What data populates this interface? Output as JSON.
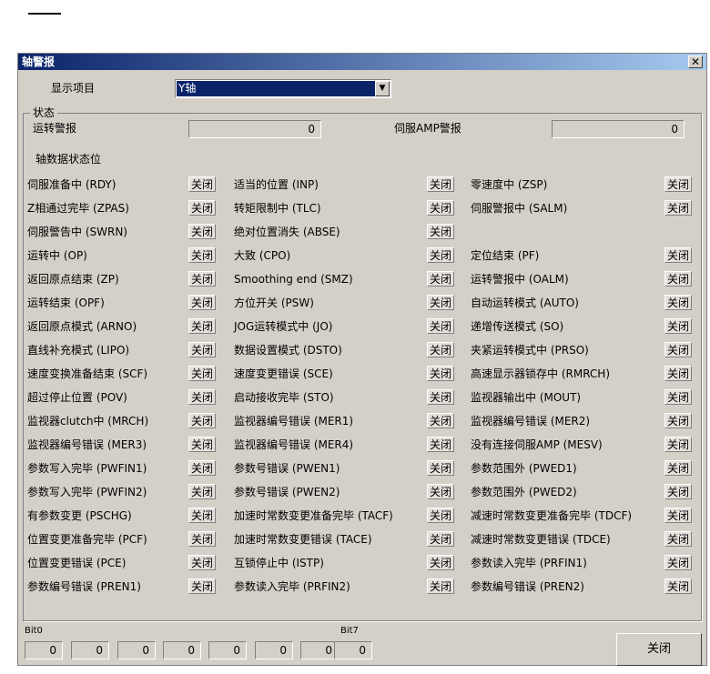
{
  "window": {
    "title": "轴警报",
    "close_glyph": "✕",
    "ok_button": "关闭"
  },
  "display": {
    "label": "显示项目",
    "selected": "Y轴",
    "arrow": "▼"
  },
  "status": {
    "legend": "状态",
    "run_alarm_label": "运转警报",
    "run_alarm_value": "0",
    "servo_amp_label": "伺服AMP警报",
    "servo_amp_value": "0"
  },
  "bits_heading": "轴数据状态位",
  "items": [
    [
      {
        "label": "伺服准备中 (RDY)",
        "state": "关闭"
      },
      {
        "label": "适当的位置 (INP)",
        "state": "关闭"
      },
      {
        "label": "零速度中 (ZSP)",
        "state": "关闭"
      }
    ],
    [
      {
        "label": "Z相通过完毕 (ZPAS)",
        "state": "关闭"
      },
      {
        "label": "转矩限制中 (TLC)",
        "state": "关闭"
      },
      {
        "label": "伺服警报中 (SALM)",
        "state": "关闭"
      }
    ],
    [
      {
        "label": "伺服警告中 (SWRN)",
        "state": "关闭"
      },
      {
        "label": "绝对位置消失 (ABSE)",
        "state": "关闭"
      },
      null
    ],
    [
      {
        "label": "运转中 (OP)",
        "state": "关闭"
      },
      {
        "label": "大致 (CPO)",
        "state": "关闭"
      },
      {
        "label": "定位结束 (PF)",
        "state": "关闭"
      }
    ],
    [
      {
        "label": "返回原点结束 (ZP)",
        "state": "关闭"
      },
      {
        "label": "Smoothing end (SMZ)",
        "state": "关闭"
      },
      {
        "label": "运转警报中 (OALM)",
        "state": "关闭"
      }
    ],
    [
      {
        "label": "运转结束 (OPF)",
        "state": "关闭"
      },
      {
        "label": "方位开关 (PSW)",
        "state": "关闭"
      },
      {
        "label": "自动运转模式 (AUTO)",
        "state": "关闭"
      }
    ],
    [
      {
        "label": "返回原点模式 (ARNO)",
        "state": "关闭"
      },
      {
        "label": "JOG运转模式中 (JO)",
        "state": "关闭"
      },
      {
        "label": "递增传送模式 (SO)",
        "state": "关闭"
      }
    ],
    [
      {
        "label": "直线补充模式 (LIPO)",
        "state": "关闭"
      },
      {
        "label": "数据设置模式 (DSTO)",
        "state": "关闭"
      },
      {
        "label": "夹紧运转模式中 (PRSO)",
        "state": "关闭"
      }
    ],
    [
      {
        "label": "速度变换准备结束 (SCF)",
        "state": "关闭"
      },
      {
        "label": "速度变更错误 (SCE)",
        "state": "关闭"
      },
      {
        "label": "高速显示器锁存中 (RMRCH)",
        "state": "关闭"
      }
    ],
    [
      {
        "label": "超过停止位置 (POV)",
        "state": "关闭"
      },
      {
        "label": "启动接收完毕 (STO)",
        "state": "关闭"
      },
      {
        "label": "监视器输出中 (MOUT)",
        "state": "关闭"
      }
    ],
    [
      {
        "label": "监视器clutch中 (MRCH)",
        "state": "关闭"
      },
      {
        "label": "监视器编号错误 (MER1)",
        "state": "关闭"
      },
      {
        "label": "监视器编号错误 (MER2)",
        "state": "关闭"
      }
    ],
    [
      {
        "label": "监视器编号错误 (MER3)",
        "state": "关闭"
      },
      {
        "label": "监视器编号错误 (MER4)",
        "state": "关闭"
      },
      {
        "label": "没有连接伺服AMP (MESV)",
        "state": "关闭"
      }
    ],
    [
      {
        "label": "参数写入完毕 (PWFIN1)",
        "state": "关闭"
      },
      {
        "label": "参数号错误 (PWEN1)",
        "state": "关闭"
      },
      {
        "label": "参数范围外 (PWED1)",
        "state": "关闭"
      }
    ],
    [
      {
        "label": "参数写入完毕 (PWFIN2)",
        "state": "关闭"
      },
      {
        "label": "参数号错误 (PWEN2)",
        "state": "关闭"
      },
      {
        "label": "参数范围外 (PWED2)",
        "state": "关闭"
      }
    ],
    [
      {
        "label": "有参数变更 (PSCHG)",
        "state": "关闭"
      },
      {
        "label": "加速时常数变更准备完毕 (TACF)",
        "state": "关闭"
      },
      {
        "label": "减速时常数变更准备完毕 (TDCF)",
        "state": "关闭"
      }
    ],
    [
      {
        "label": "位置变更准备完毕 (PCF)",
        "state": "关闭"
      },
      {
        "label": "加速时常数变更错误 (TACE)",
        "state": "关闭"
      },
      {
        "label": "减速时常数变更错误 (TDCE)",
        "state": "关闭"
      }
    ],
    [
      {
        "label": "位置变更错误 (PCE)",
        "state": "关闭"
      },
      {
        "label": "互锁停止中 (ISTP)",
        "state": "关闭"
      },
      {
        "label": "参数读入完毕 (PRFIN1)",
        "state": "关闭"
      }
    ],
    [
      {
        "label": "参数编号错误 (PREN1)",
        "state": "关闭"
      },
      {
        "label": "参数读入完毕 (PRFIN2)",
        "state": "关闭"
      },
      {
        "label": "参数编号错误 (PREN2)",
        "state": "关闭"
      }
    ]
  ],
  "bits": {
    "start_label": "Bit0",
    "end_label": "Bit7",
    "values": [
      "0",
      "0",
      "0",
      "0",
      "0",
      "0",
      "0",
      "0"
    ]
  }
}
